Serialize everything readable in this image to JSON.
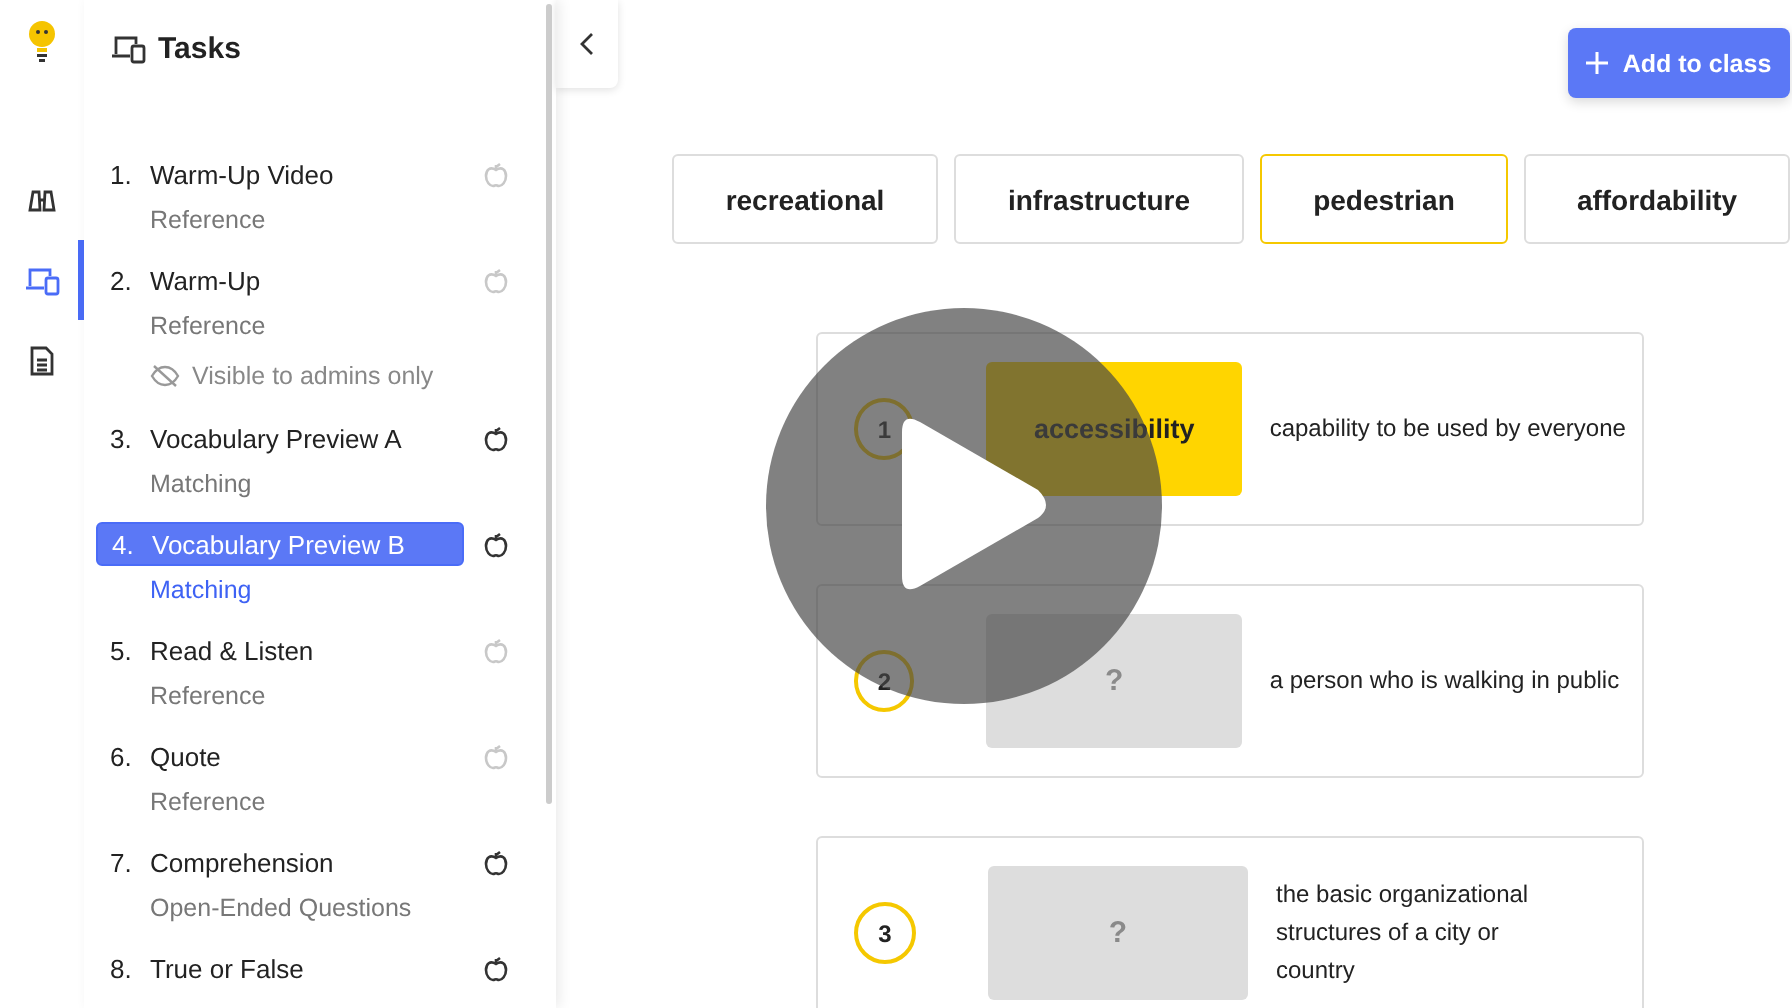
{
  "rail": [
    {
      "kind": "binoculars",
      "selected": false
    },
    {
      "kind": "devices",
      "selected": true
    },
    {
      "kind": "document",
      "selected": false
    }
  ],
  "sidebar": {
    "title": "Tasks",
    "tasks": [
      {
        "number": "1.",
        "title": "Warm-Up Video",
        "subtitle": "Reference",
        "active": false,
        "selected": false
      },
      {
        "number": "2.",
        "title": "Warm-Up",
        "subtitle": "Reference",
        "note": "Visible to admins only",
        "active": false,
        "selected": false
      },
      {
        "number": "3.",
        "title": "Vocabulary Preview A",
        "subtitle": "Matching",
        "active": true,
        "selected": false
      },
      {
        "number": "4.",
        "title": "Vocabulary Preview B",
        "subtitle": "Matching",
        "active": true,
        "selected": true
      },
      {
        "number": "5.",
        "title": "Read & Listen",
        "subtitle": "Reference",
        "active": false,
        "selected": false
      },
      {
        "number": "6.",
        "title": "Quote",
        "subtitle": "Reference",
        "active": false,
        "selected": false
      },
      {
        "number": "7.",
        "title": "Comprehension",
        "subtitle": "Open-Ended Questions",
        "active": true,
        "selected": false
      },
      {
        "number": "8.",
        "title": "True or False",
        "active": true,
        "selected": false
      }
    ]
  },
  "add_button": "Add to class",
  "words": [
    {
      "text": "recreational",
      "selected": false
    },
    {
      "text": "infrastructure",
      "selected": false
    },
    {
      "text": "pedestrian",
      "selected": true
    },
    {
      "text": "affordability",
      "selected": false
    }
  ],
  "matches": [
    {
      "number": "1",
      "answer": "accessibility",
      "filled": true,
      "definition": "capability to be used by everyone"
    },
    {
      "number": "2",
      "answer": "?",
      "filled": false,
      "definition": "a person who is walking in public"
    },
    {
      "number": "3",
      "answer": "?",
      "filled": false,
      "definition": "the basic organizational structures of a city or country"
    }
  ]
}
